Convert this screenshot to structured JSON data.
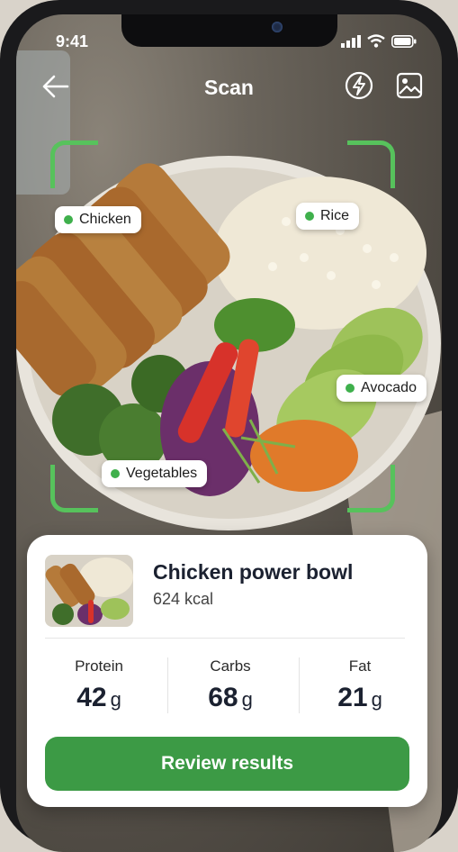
{
  "status_bar": {
    "time": "9:41"
  },
  "header": {
    "title": "Scan"
  },
  "detections": [
    {
      "label": "Chicken"
    },
    {
      "label": "Rice"
    },
    {
      "label": "Avocado"
    },
    {
      "label": "Vegetables"
    }
  ],
  "result": {
    "dish_name": "Chicken power bowl",
    "calories": "624 kcal",
    "macros": [
      {
        "label": "Protein",
        "value": "42",
        "unit": "g"
      },
      {
        "label": "Carbs",
        "value": "68",
        "unit": "g"
      },
      {
        "label": "Fat",
        "value": "21",
        "unit": "g"
      }
    ],
    "button_label": "Review results"
  },
  "colors": {
    "accent": "#3c9a45",
    "scan_frame": "#57c25c",
    "detection_dot": "#3fb04c"
  },
  "icons": [
    "back-arrow-icon",
    "flash-icon",
    "gallery-icon",
    "signal-icon",
    "wifi-icon",
    "battery-icon"
  ]
}
